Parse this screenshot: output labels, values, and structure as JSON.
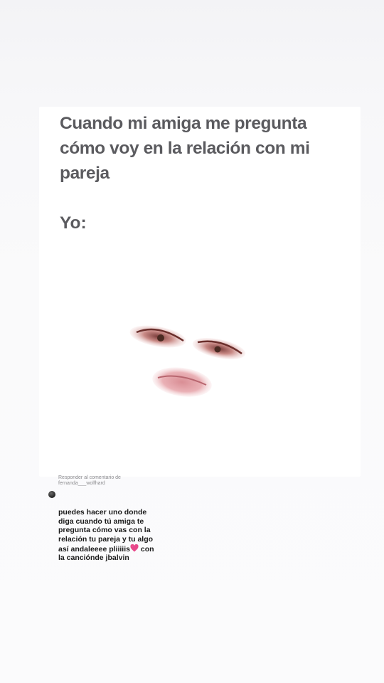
{
  "meme": {
    "caption_lines": [
      "Cuando mi amiga me pregunta",
      "cómo voy en la relación con mi",
      "pareja"
    ],
    "punchline": "Yo:"
  },
  "reply": {
    "header_lines": [
      "Responder al comentario de",
      "fernanda___wolfhard"
    ],
    "body_before_emoji": "puedes hacer uno donde\ndiga cuando tú amiga te\npregunta cómo vas con la\nrelación tu pareja y tu algo\nasí andaleeee pliiiiis",
    "emoji": "sparkling-heart-icon",
    "body_after_emoji": " con\nla canciónde jbalvin"
  },
  "colors": {
    "caption": "#5b5b5f",
    "heart": "#e8488a",
    "background": "#f6f6f8"
  }
}
